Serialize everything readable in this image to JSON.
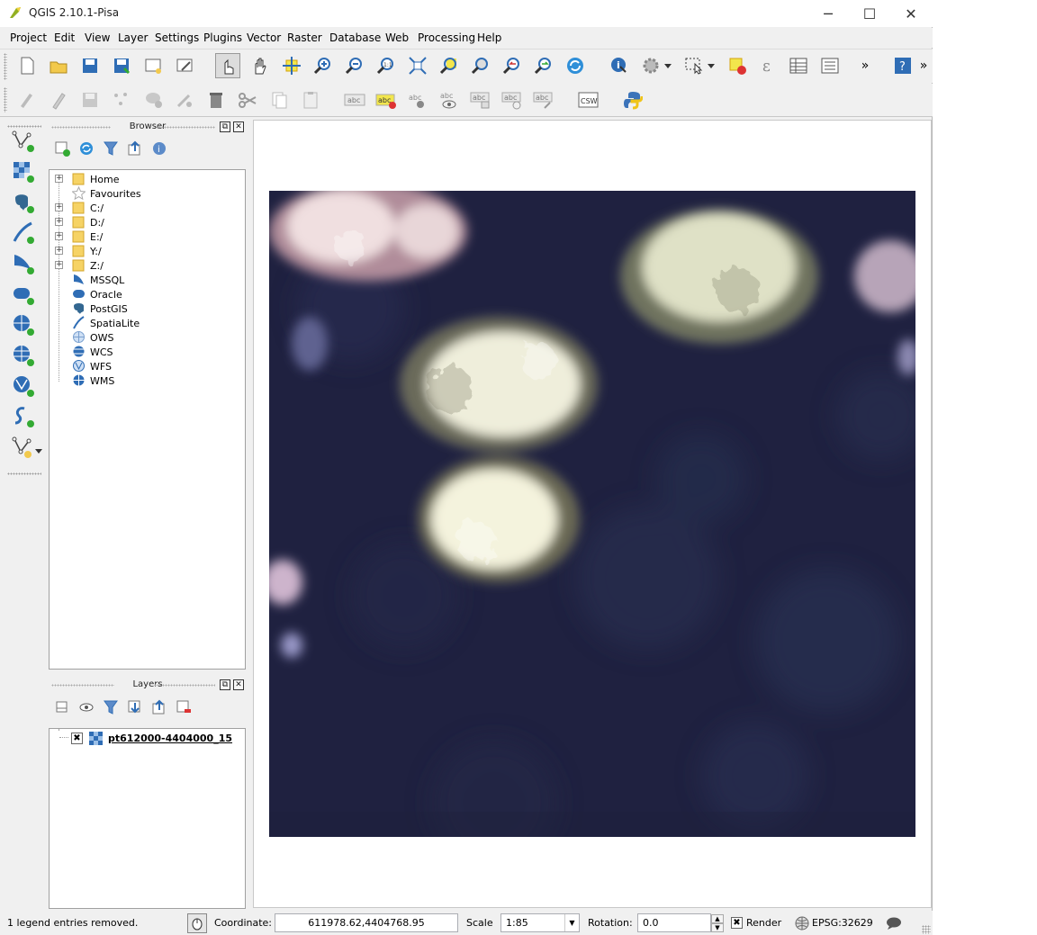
{
  "window": {
    "title": "QGIS 2.10.1-Pisa",
    "minimize_glyph": "─",
    "maximize_glyph": "☐",
    "close_glyph": "✕"
  },
  "menu": [
    "Project",
    "Edit",
    "View",
    "Layer",
    "Settings",
    "Plugins",
    "Vector",
    "Raster",
    "Database",
    "Web",
    "Processing",
    "Help"
  ],
  "toolbar1": {
    "overflow_glyph": "»"
  },
  "toolbar2": {
    "labels": {
      "abc": "abc",
      "csw": "CSW"
    }
  },
  "browser": {
    "title": "Browser",
    "float_glyph": "⧉",
    "close_glyph": "✕",
    "items": [
      {
        "label": "Home",
        "icon": "folder-icon",
        "expand": "+"
      },
      {
        "label": "Favourites",
        "icon": "star-icon",
        "expand": ""
      },
      {
        "label": "C:/",
        "icon": "folder-icon",
        "expand": "+"
      },
      {
        "label": "D:/",
        "icon": "folder-icon",
        "expand": "+"
      },
      {
        "label": "E:/",
        "icon": "folder-icon",
        "expand": "+"
      },
      {
        "label": "Y:/",
        "icon": "folder-icon",
        "expand": "+"
      },
      {
        "label": "Z:/",
        "icon": "folder-icon",
        "expand": "+"
      },
      {
        "label": "MSSQL",
        "icon": "mssql-icon",
        "expand": ""
      },
      {
        "label": "Oracle",
        "icon": "oracle-icon",
        "expand": ""
      },
      {
        "label": "PostGIS",
        "icon": "postgis-icon",
        "expand": ""
      },
      {
        "label": "SpatiaLite",
        "icon": "spatialite-icon",
        "expand": ""
      },
      {
        "label": "OWS",
        "icon": "ows-icon",
        "expand": ""
      },
      {
        "label": "WCS",
        "icon": "wcs-icon",
        "expand": ""
      },
      {
        "label": "WFS",
        "icon": "wfs-icon",
        "expand": ""
      },
      {
        "label": "WMS",
        "icon": "wms-icon",
        "expand": ""
      }
    ]
  },
  "layers": {
    "title": "Layers",
    "float_glyph": "⧉",
    "close_glyph": "✕",
    "items": [
      {
        "name": "pt612000-4404000_15",
        "checked_glyph": "✖"
      }
    ]
  },
  "status": {
    "message": "1 legend entries removed.",
    "coordinate_label": "Coordinate:",
    "coordinate_value": "611978.62,4404768.95",
    "scale_label": "Scale",
    "scale_value": "1:85",
    "scale_dropdown_glyph": "▼",
    "rotation_label": "Rotation:",
    "rotation_value": "0.0",
    "spin_up": "▲",
    "spin_down": "▼",
    "render_checked_glyph": "✖",
    "render_label": "Render",
    "crs": "EPSG:32629"
  },
  "colors": {
    "raster_bg": "#20223f",
    "folder": "#f6d365",
    "accent_blue": "#2f6db5"
  }
}
